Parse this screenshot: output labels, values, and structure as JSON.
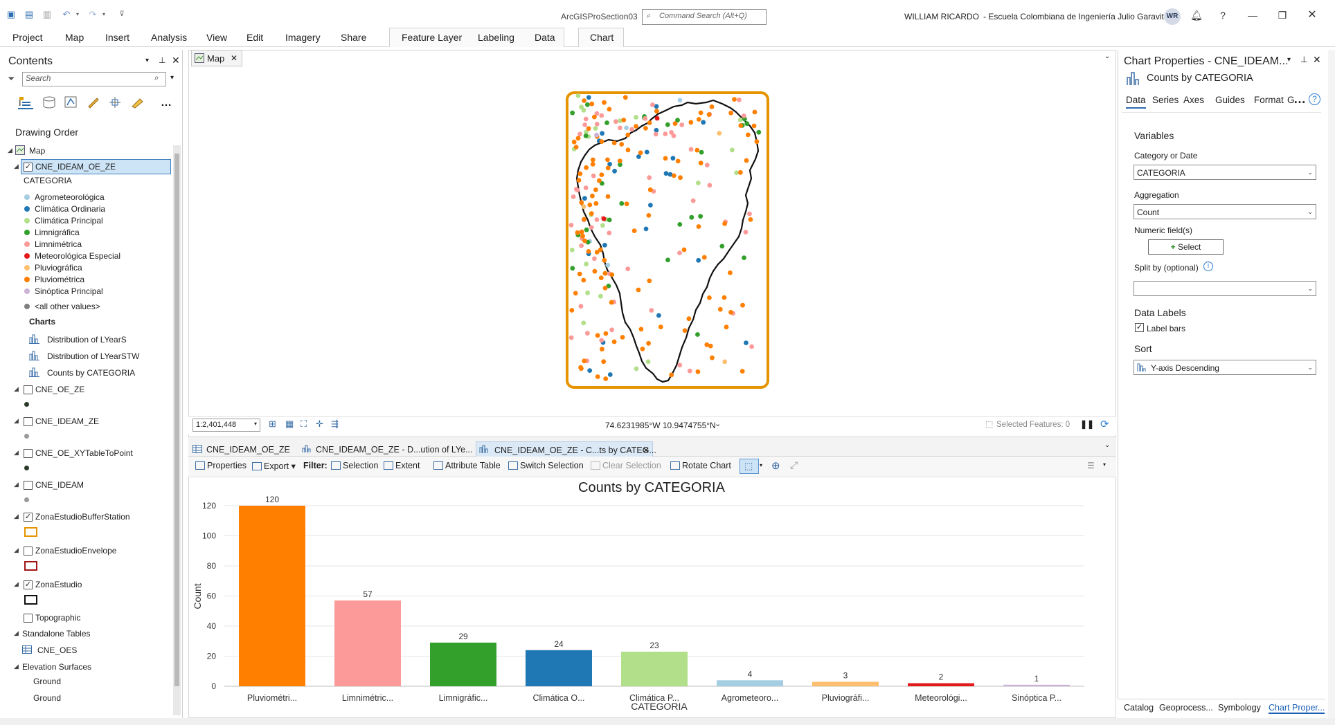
{
  "app": {
    "title": "ArcGISProSection03",
    "search_placeholder": "Command Search (Alt+Q)",
    "user": "WILLIAM RICARDO",
    "org": "Escuela Colombiana de Ingeniería Julio Garavito",
    "avatar": "WR"
  },
  "ribbon": {
    "tabs": [
      "Project",
      "Map",
      "Insert",
      "Analysis",
      "View",
      "Edit",
      "Imagery",
      "Share"
    ],
    "context_tabs": [
      "Feature Layer",
      "Labeling",
      "Data"
    ],
    "chart_tab": "Chart"
  },
  "contents": {
    "title": "Contents",
    "search_placeholder": "Search",
    "section": "Drawing Order",
    "map_label": "Map",
    "layer": "CNE_IDEAM_OE_ZE",
    "field": "CATEGORIA",
    "categories": [
      {
        "label": "Agrometeorológica",
        "color": "#a6cee3"
      },
      {
        "label": "Climática Ordinaria",
        "color": "#1f78b4"
      },
      {
        "label": "Climática Principal",
        "color": "#b2df8a"
      },
      {
        "label": "Limnigráfica",
        "color": "#33a02c"
      },
      {
        "label": "Limnimétrica",
        "color": "#fb9a99"
      },
      {
        "label": "Meteorológica Especial",
        "color": "#e31a1c"
      },
      {
        "label": "Pluviográfica",
        "color": "#fdbf6f"
      },
      {
        "label": "Pluviométrica",
        "color": "#ff7f00"
      },
      {
        "label": "Sinóptica Principal",
        "color": "#cab2d6"
      },
      {
        "label": "<all other values>",
        "color": "#808080"
      }
    ],
    "charts_label": "Charts",
    "charts": [
      "Distribution of LYearS",
      "Distribution of LYearSTW",
      "Counts by CATEGORIA"
    ],
    "layers": [
      {
        "label": "CNE_OE_ZE",
        "checked": false,
        "symbol": "dot",
        "color": "#2b3a2b"
      },
      {
        "label": "CNE_IDEAM_ZE",
        "checked": false,
        "symbol": "dot",
        "color": "#9a9a9a"
      },
      {
        "label": "CNE_OE_XYTableToPoint",
        "checked": false,
        "symbol": "dot",
        "color": "#2b3a2b"
      },
      {
        "label": "CNE_IDEAM",
        "checked": false,
        "symbol": "dot",
        "color": "#9a9a9a"
      },
      {
        "label": "ZonaEstudioBufferStation",
        "checked": true,
        "symbol": "rect",
        "color": "#e59400"
      },
      {
        "label": "ZonaEstudioEnvelope",
        "checked": false,
        "symbol": "rect",
        "color": "#a31515"
      },
      {
        "label": "ZonaEstudio",
        "checked": true,
        "symbol": "rect",
        "color": "#111111"
      }
    ],
    "topographic": "Topographic",
    "standalone": "Standalone Tables",
    "table": "CNE_OES",
    "elevation": "Elevation Surfaces",
    "ground1": "Ground",
    "ground2": "Ground"
  },
  "map": {
    "tab": "Map",
    "scale": "1:2,401,448",
    "coords": "74.6231985°W 10.9474755°N",
    "selected": "Selected Features: 0"
  },
  "chartpane": {
    "tabs": [
      "CNE_IDEAM_OE_ZE",
      "CNE_IDEAM_OE_ZE - D...ution of LYe...",
      "CNE_IDEAM_OE_ZE - C...ts by CATEG..."
    ],
    "toolbar": {
      "properties": "Properties",
      "export": "Export",
      "filter": "Filter:",
      "selection": "Selection",
      "extent": "Extent",
      "attribute_table": "Attribute Table",
      "switch_selection": "Switch Selection",
      "clear_selection": "Clear Selection",
      "rotate_chart": "Rotate Chart"
    }
  },
  "chart_data": {
    "type": "bar",
    "title": "Counts by CATEGORIA",
    "xlabel": "CATEGORIA",
    "ylabel": "Count",
    "ylim": [
      0,
      120
    ],
    "yticks": [
      0,
      20,
      40,
      60,
      80,
      100,
      120
    ],
    "categories": [
      "Pluviométri...",
      "Limnimétric...",
      "Limnigráfic...",
      "Climática O...",
      "Climática P...",
      "Agrometeoro...",
      "Pluviográfi...",
      "Meteorológi...",
      "Sinóptica P..."
    ],
    "values": [
      120,
      57,
      29,
      24,
      23,
      4,
      3,
      2,
      1
    ],
    "colors": [
      "#ff7f00",
      "#fb9a99",
      "#33a02c",
      "#1f78b4",
      "#b2df8a",
      "#a6cee3",
      "#fdbf6f",
      "#e31a1c",
      "#cab2d6"
    ],
    "grid": true
  },
  "props": {
    "title": "Chart Properties - CNE_IDEAM...",
    "subtitle": "Counts by CATEGORIA",
    "tabs": [
      "Data",
      "Series",
      "Axes",
      "Guides",
      "Format",
      "G"
    ],
    "variables": "Variables",
    "cat_label": "Category or Date",
    "cat_value": "CATEGORIA",
    "agg_label": "Aggregation",
    "agg_value": "Count",
    "numeric_label": "Numeric field(s)",
    "select_btn": "Select",
    "split_label": "Split by (optional)",
    "split_value": "",
    "data_labels": "Data Labels",
    "label_bars": "Label bars",
    "sort_label": "Sort",
    "sort_value": "Y-axis Descending",
    "bottom_tabs": [
      "Catalog",
      "Geoprocess...",
      "Symbology",
      "Chart Proper..."
    ]
  }
}
